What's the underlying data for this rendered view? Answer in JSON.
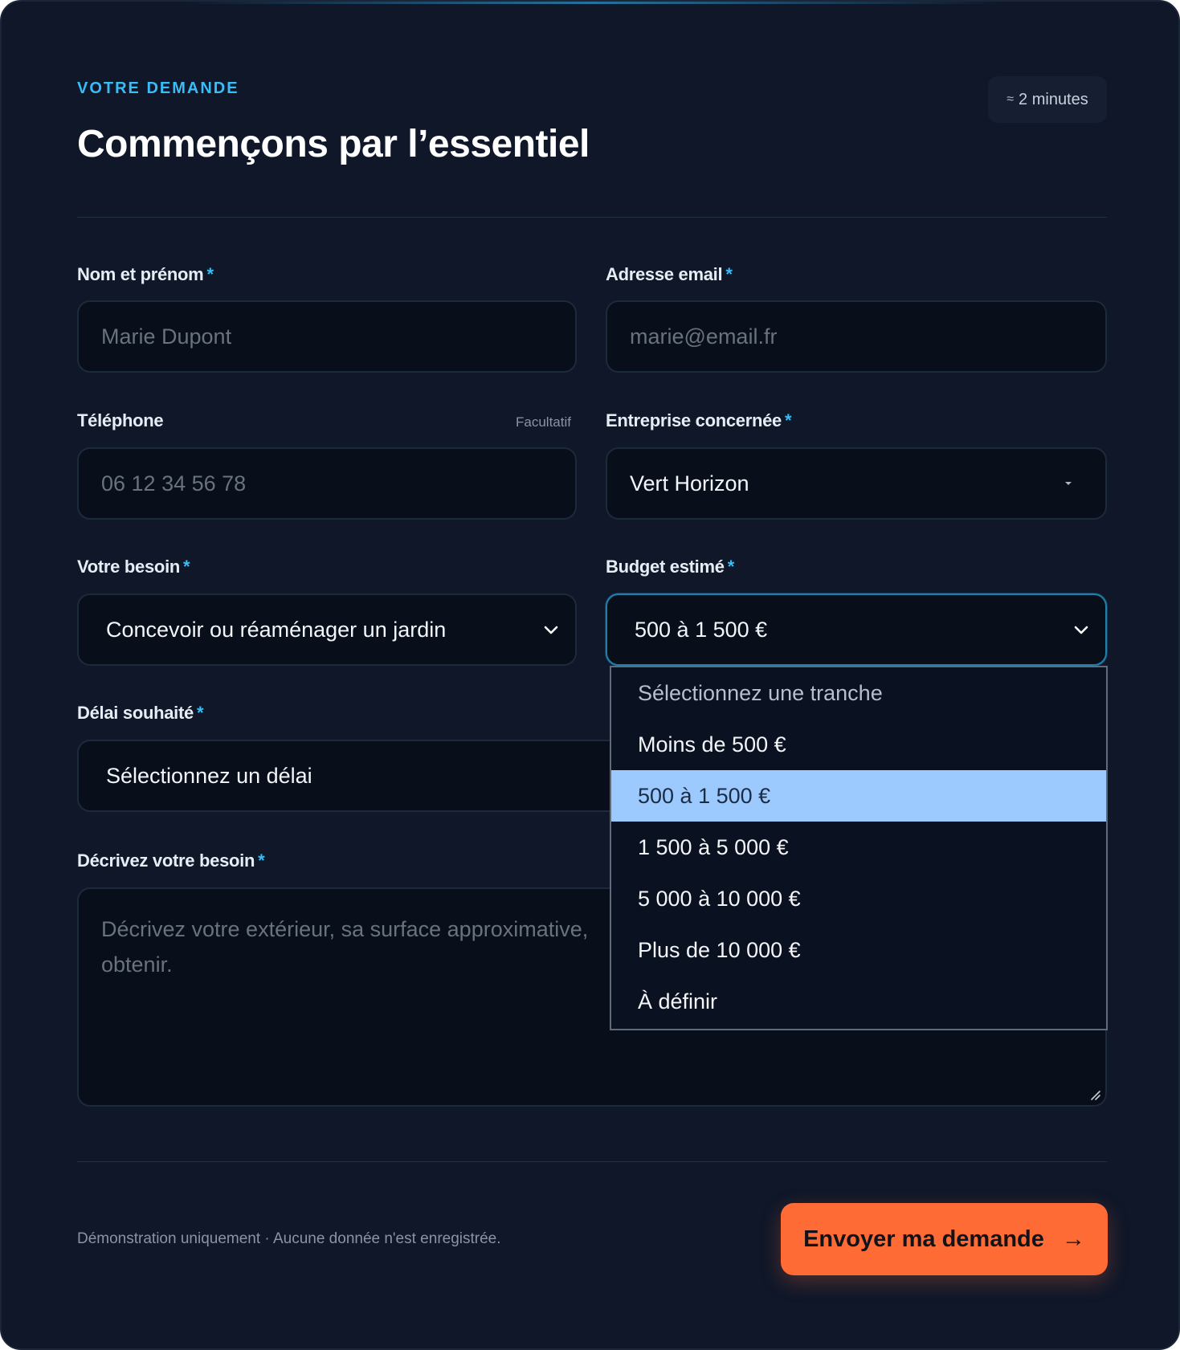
{
  "header": {
    "eyebrow": "VOTRE DEMANDE",
    "title": "Commençons par l’essentiel",
    "time_approx": "≈",
    "time_label": "2 minutes"
  },
  "fields": {
    "name": {
      "label": "Nom et prénom",
      "required": "*",
      "placeholder": "Marie Dupont"
    },
    "email": {
      "label": "Adresse email",
      "required": "*",
      "placeholder": "marie@email.fr"
    },
    "phone": {
      "label": "Téléphone",
      "optional": "Facultatif",
      "placeholder": "06 12 34 56 78"
    },
    "company": {
      "label": "Entreprise concernée",
      "required": "*",
      "value": "Vert Horizon"
    },
    "need": {
      "label": "Votre besoin",
      "required": "*",
      "value": "Concevoir ou réaménager un jardin"
    },
    "budget": {
      "label": "Budget estimé",
      "required": "*",
      "value": "500 à 1 500 €",
      "options": [
        "Sélectionnez une tranche",
        "Moins de 500 €",
        "500 à 1 500 €",
        "1 500 à 5 000 €",
        "5 000 à 10 000 €",
        "Plus de 10 000 €",
        "À définir"
      ],
      "selected_index": 2
    },
    "delay": {
      "label": "Délai souhaité",
      "required": "*",
      "value": "Sélectionnez un délai"
    },
    "description": {
      "label": "Décrivez votre besoin",
      "required": "*",
      "placeholder_line1": "Décrivez votre extérieur, sa surface approximative,",
      "placeholder_line2": "obtenir."
    }
  },
  "footer": {
    "note": "Démonstration uniquement · Aucune donnée n'est enregistrée.",
    "submit_label": "Envoyer ma demande",
    "submit_arrow": "→"
  },
  "colors": {
    "background": "#0f1729",
    "accent": "#38bdf8",
    "button": "#ff6b35",
    "selected_option": "#9ccaff"
  }
}
